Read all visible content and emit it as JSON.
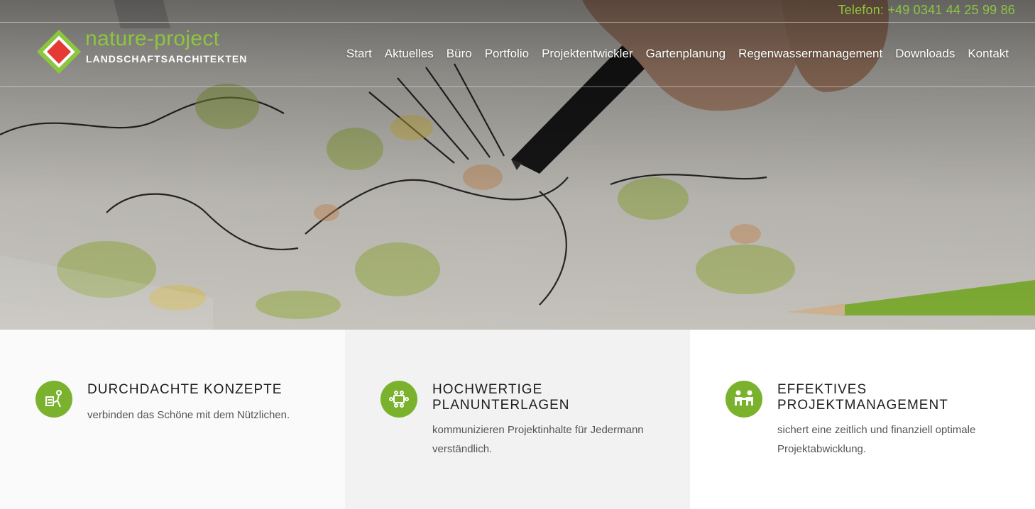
{
  "header": {
    "phone": "Telefon: +49 0341 44 25 99 86",
    "logo": {
      "name": "nature-project",
      "subtitle": "LANDSCHAFTSARCHITEKTEN"
    },
    "nav": [
      "Start",
      "Aktuelles",
      "Büro",
      "Portfolio",
      "Projektentwickler",
      "Gartenplanung",
      "Regenwassermanagement",
      "Downloads",
      "Kontakt"
    ]
  },
  "colors": {
    "accent_green": "#8cc63f",
    "icon_green": "#7ab22e",
    "logo_red": "#e53935"
  },
  "features": [
    {
      "icon": "planning-icon",
      "title": "DURCHDACHTE KONZEPTE",
      "text": "verbinden das Schöne mit dem Nützlichen."
    },
    {
      "icon": "meeting-table-icon",
      "title": "HOCHWERTIGE PLANUNTERLAGEN",
      "text": "kommunizieren Projektinhalte für Jedermann verständlich."
    },
    {
      "icon": "people-icon",
      "title": "EFFEKTIVES PROJEKTMANAGEMENT",
      "text": "sichert eine zeitlich und finanziell optimale Projektabwicklung."
    }
  ]
}
